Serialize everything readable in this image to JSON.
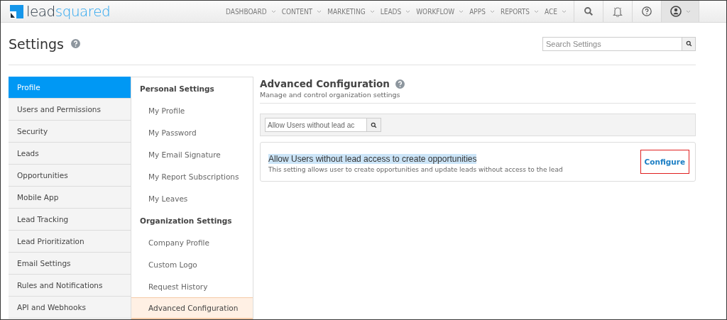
{
  "logo": {
    "parts": [
      "lead",
      "squared"
    ]
  },
  "nav": [
    {
      "label": "DASHBOARD"
    },
    {
      "label": "CONTENT"
    },
    {
      "label": "MARKETING"
    },
    {
      "label": "LEADS"
    },
    {
      "label": "WORKFLOW"
    },
    {
      "label": "APPS"
    },
    {
      "label": "REPORTS"
    },
    {
      "label": "ACE"
    }
  ],
  "page": {
    "title": "Settings",
    "search": {
      "placeholder": "Search Settings"
    }
  },
  "sidebar": {
    "items": [
      {
        "label": "Profile",
        "selected": true
      },
      {
        "label": "Users and Permissions",
        "selected": false
      },
      {
        "label": "Security",
        "selected": false
      },
      {
        "label": "Leads",
        "selected": false
      },
      {
        "label": "Opportunities",
        "selected": false
      },
      {
        "label": "Mobile App",
        "selected": false
      },
      {
        "label": "Lead Tracking",
        "selected": false
      },
      {
        "label": "Lead Prioritization",
        "selected": false
      },
      {
        "label": "Email Settings",
        "selected": false
      },
      {
        "label": "Rules and Notifications",
        "selected": false
      },
      {
        "label": "API and Webhooks",
        "selected": false
      }
    ]
  },
  "submenu": {
    "items": [
      {
        "kind": "heading",
        "label": "Personal Settings"
      },
      {
        "kind": "item",
        "label": "My Profile",
        "selected": false
      },
      {
        "kind": "item",
        "label": "My Password",
        "selected": false
      },
      {
        "kind": "item",
        "label": "My Email Signature",
        "selected": false
      },
      {
        "kind": "item",
        "label": "My Report Subscriptions",
        "selected": false
      },
      {
        "kind": "item",
        "label": "My Leaves",
        "selected": false
      },
      {
        "kind": "heading",
        "label": "Organization Settings"
      },
      {
        "kind": "item",
        "label": "Company Profile",
        "selected": false
      },
      {
        "kind": "item",
        "label": "Custom Logo",
        "selected": false
      },
      {
        "kind": "item",
        "label": "Request History",
        "selected": false
      },
      {
        "kind": "item",
        "label": "Advanced Configuration",
        "selected": true
      }
    ]
  },
  "content": {
    "title": "Advanced Configuration",
    "subtitle": "Manage and control organization settings",
    "filter": {
      "value": "Allow Users without lead ac"
    },
    "settings": [
      {
        "title": "Allow Users without lead access to create opportunities",
        "highlighted": true,
        "description": "This setting allows user to create opportunities and update leads without access to the lead",
        "action": "Configure",
        "annotated": true
      }
    ]
  }
}
